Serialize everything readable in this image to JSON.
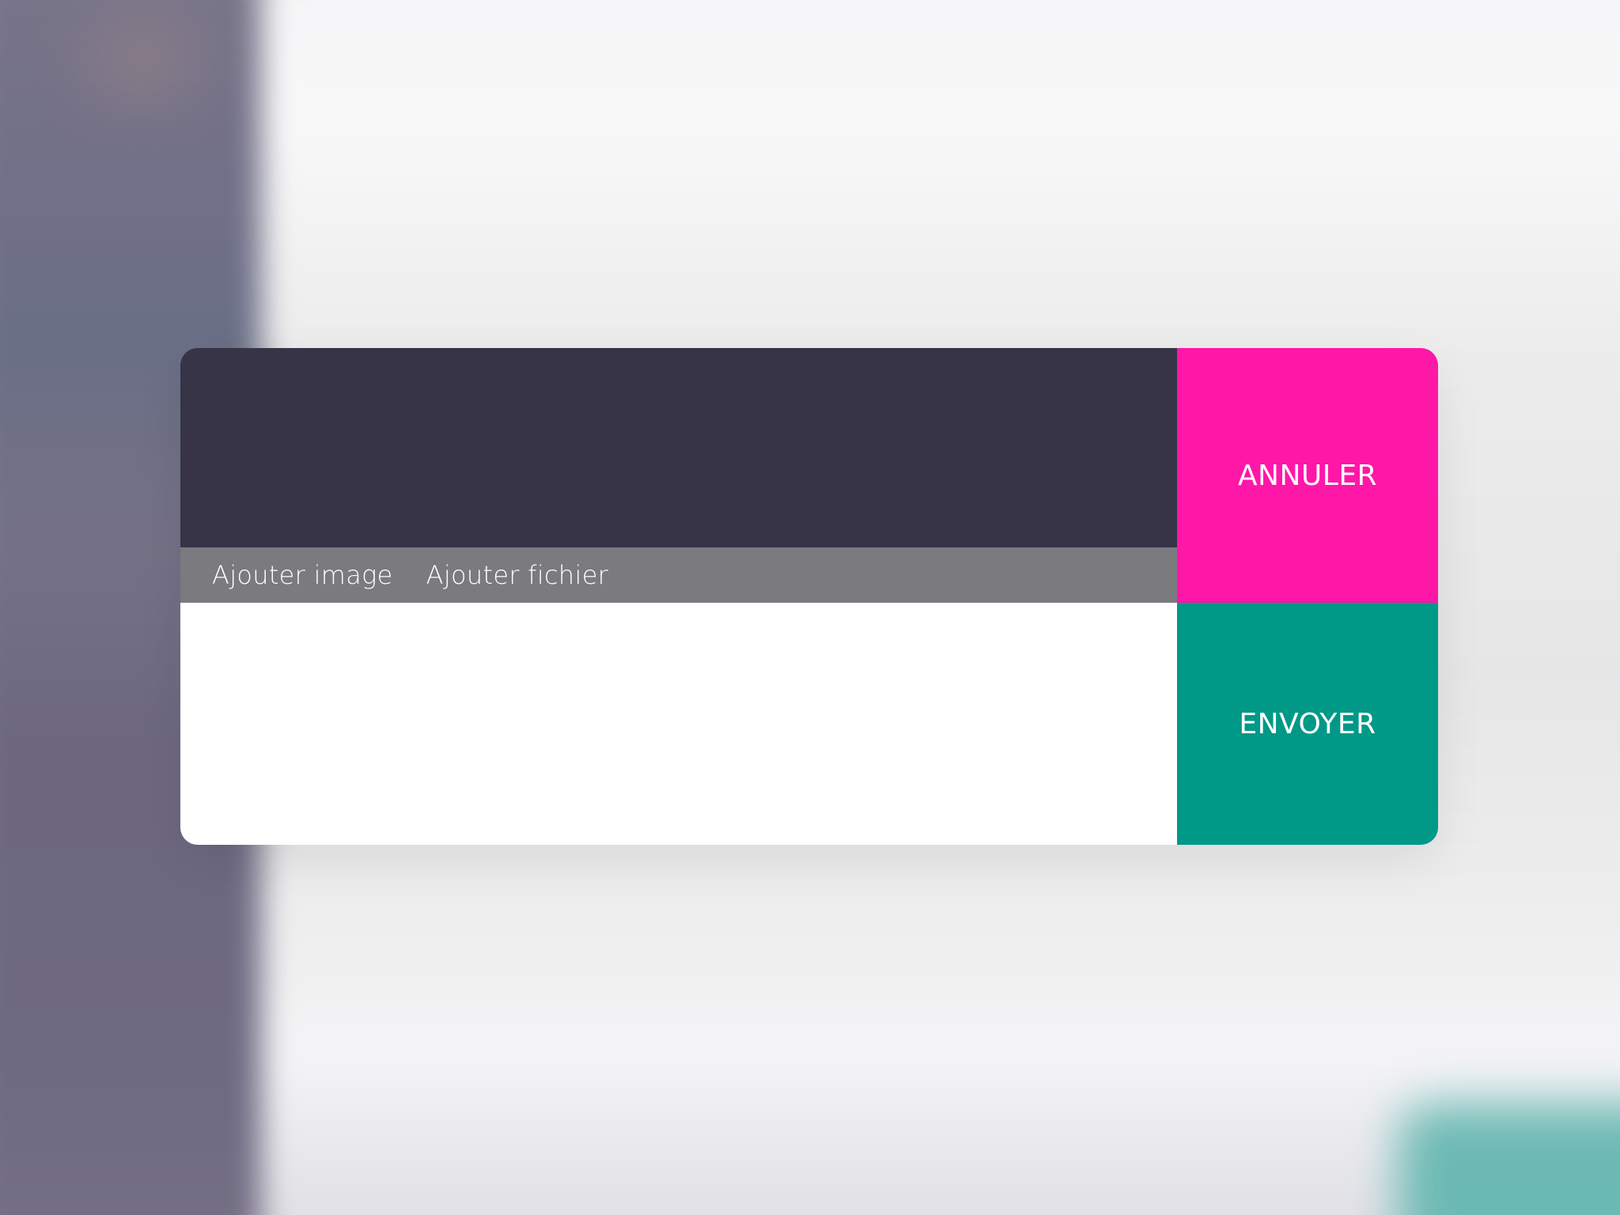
{
  "colors": {
    "preview_background": "#363446",
    "attach_bar_background": "#7a7a7f",
    "message_background": "#ffffff",
    "cancel_accent": "#ff17a8",
    "send_accent": "#009887"
  },
  "composer": {
    "attachments": {
      "add_image_label": "Ajouter image",
      "add_file_label": "Ajouter fichier"
    },
    "message": {
      "value": "",
      "placeholder": ""
    },
    "actions": {
      "cancel_label": "ANNULER",
      "send_label": "ENVOYER"
    }
  }
}
